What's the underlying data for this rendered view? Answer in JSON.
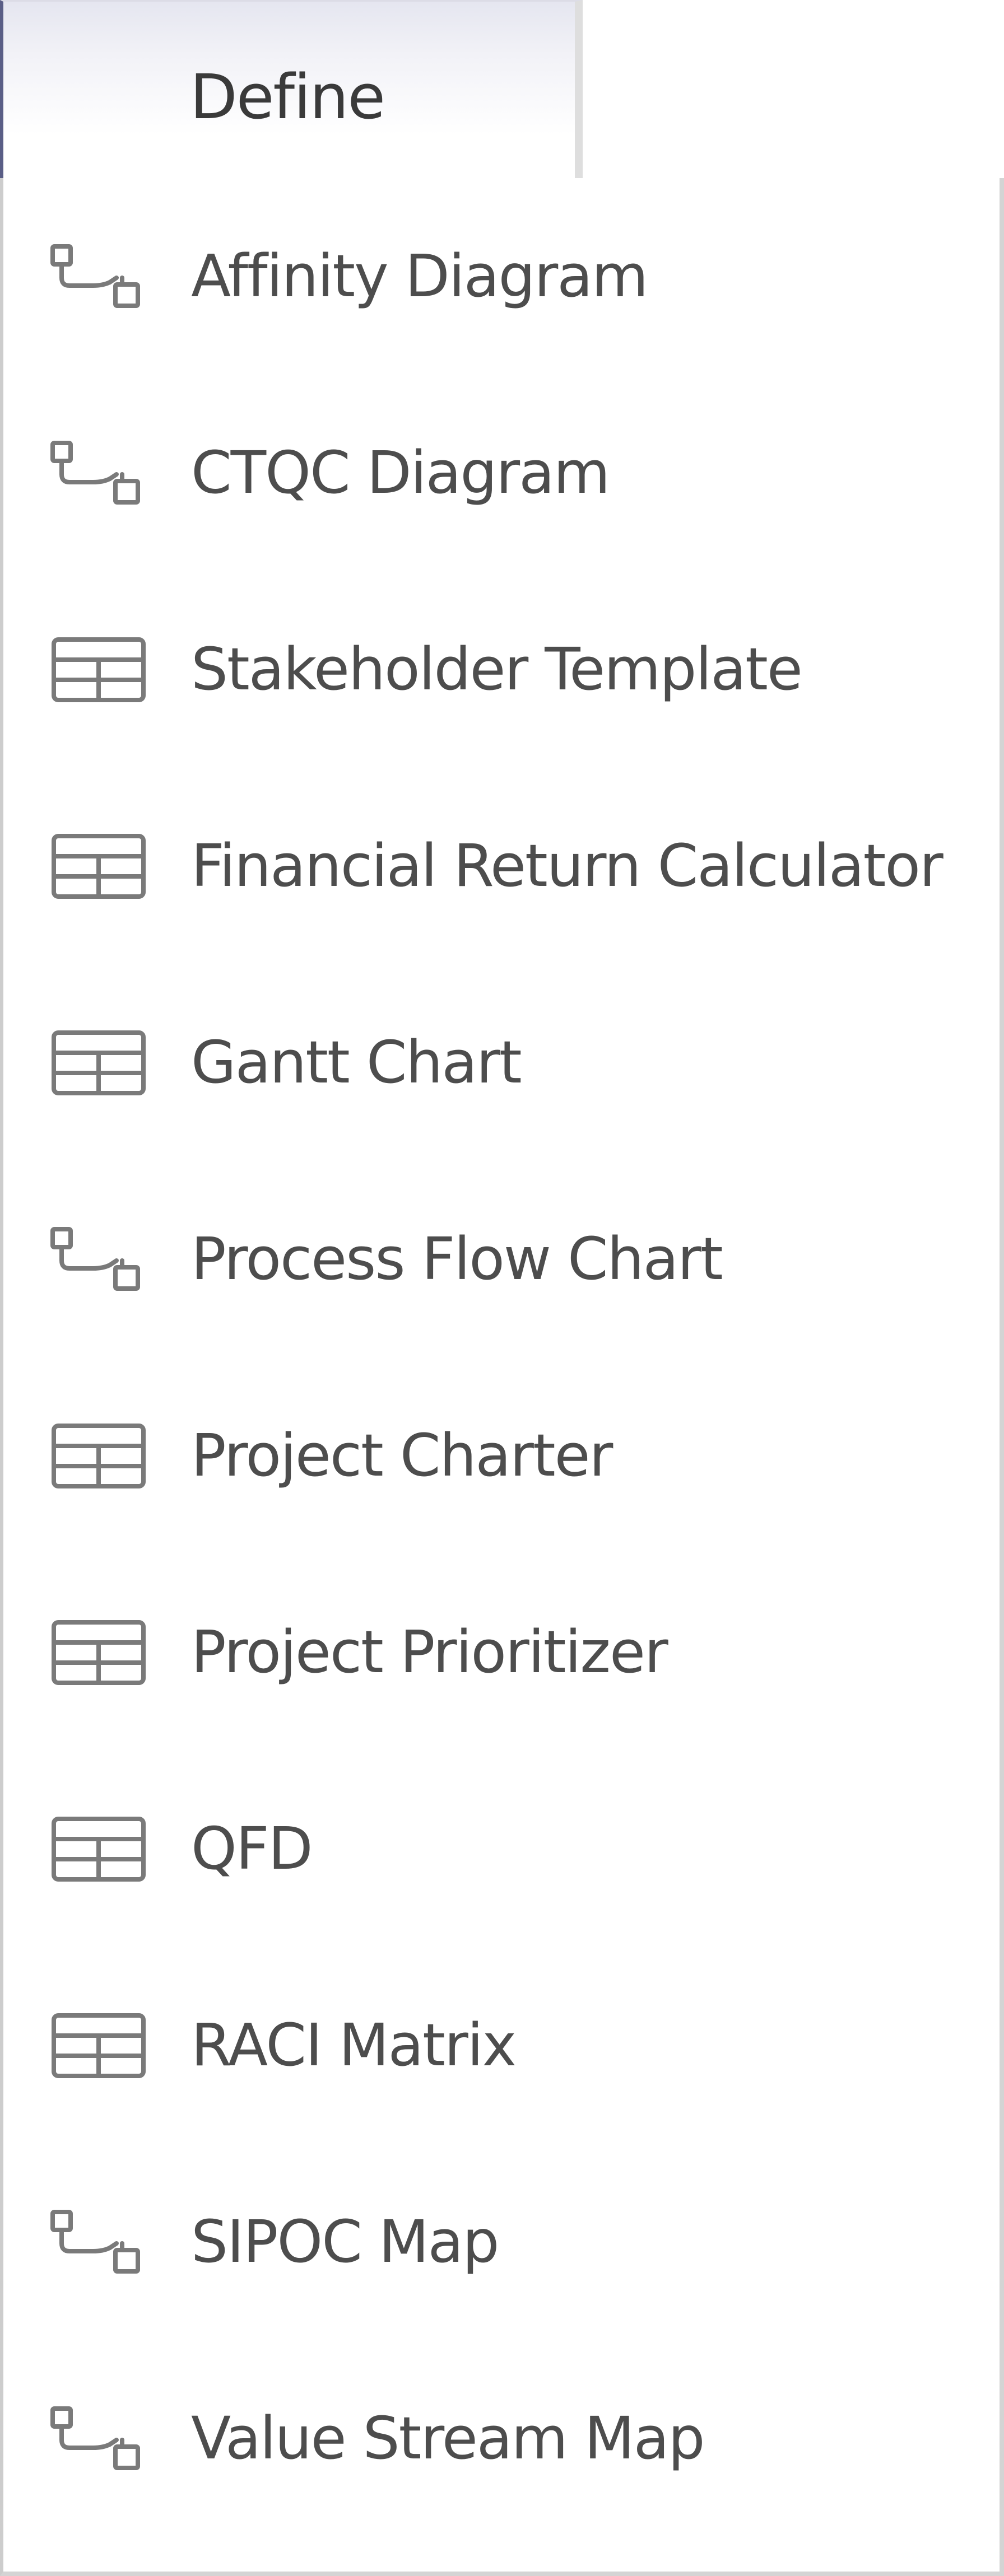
{
  "tab": {
    "label": "Define"
  },
  "menu": {
    "items": [
      {
        "label": "Affinity Diagram",
        "icon": "diagram-icon"
      },
      {
        "label": "CTQC Diagram",
        "icon": "diagram-icon"
      },
      {
        "label": "Stakeholder Template",
        "icon": "table-icon"
      },
      {
        "label": "Financial Return Calculator",
        "icon": "table-icon"
      },
      {
        "label": "Gantt Chart",
        "icon": "table-icon"
      },
      {
        "label": "Process Flow Chart",
        "icon": "diagram-icon"
      },
      {
        "label": "Project Charter",
        "icon": "table-icon"
      },
      {
        "label": "Project Prioritizer",
        "icon": "table-icon"
      },
      {
        "label": "QFD",
        "icon": "table-icon"
      },
      {
        "label": "RACI Matrix",
        "icon": "table-icon"
      },
      {
        "label": "SIPOC Map",
        "icon": "diagram-icon"
      },
      {
        "label": "Value Stream Map",
        "icon": "diagram-icon"
      }
    ]
  },
  "colors": {
    "text": "#4d4d4d",
    "icon": "#7a7a7a",
    "tab_accent": "#5a5e86",
    "border": "#d4d4d4"
  }
}
